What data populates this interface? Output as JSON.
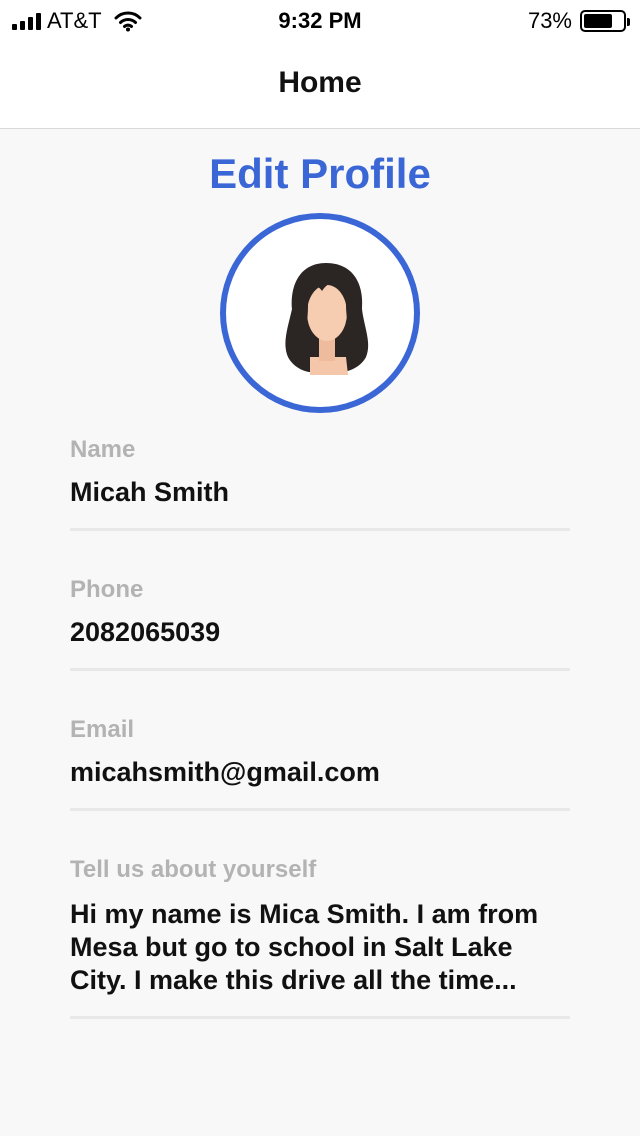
{
  "status_bar": {
    "carrier": "AT&T",
    "time": "9:32 PM",
    "battery_percent": "73%",
    "battery_level": 0.73
  },
  "nav": {
    "title": "Home"
  },
  "profile": {
    "title": "Edit Profile",
    "accent_color": "#3a66d6",
    "fields": {
      "name": {
        "label": "Name",
        "value": "Micah Smith"
      },
      "phone": {
        "label": "Phone",
        "value": "2082065039"
      },
      "email": {
        "label": "Email",
        "value": "micahsmith@gmail.com"
      },
      "about": {
        "label": "Tell us about yourself",
        "value": "Hi my name is Mica Smith. I am from Mesa but go to school in Salt Lake City. I make this drive all the time..."
      }
    }
  }
}
